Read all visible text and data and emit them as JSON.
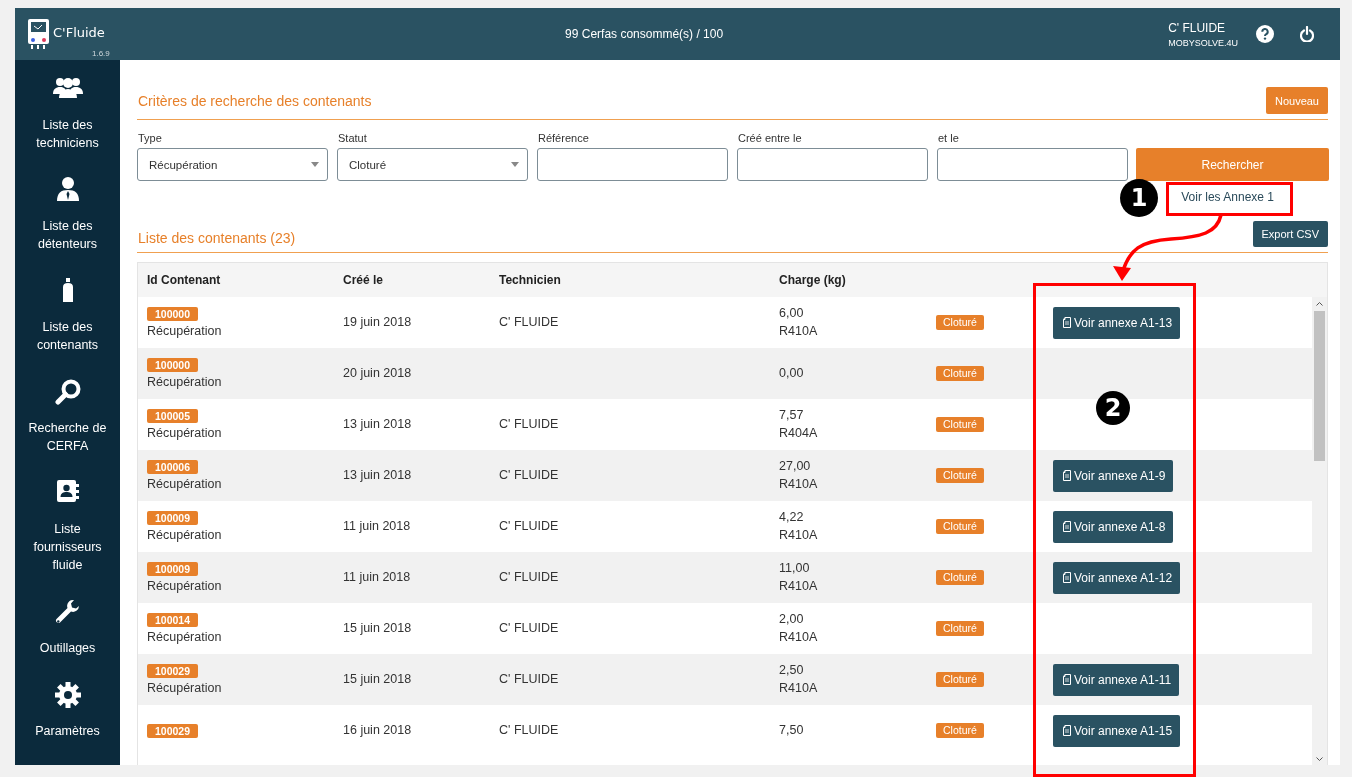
{
  "header": {
    "app_name": "C'Fluide",
    "version": "1.6.9",
    "quota": "99 Cerfas consommé(s) / 100",
    "user_name": "C' FLUIDE",
    "company": "MOBYSOLVE.4U"
  },
  "sidebar": {
    "items": [
      {
        "label": "Liste des techniciens",
        "kind": "users"
      },
      {
        "label": "Liste des détenteurs",
        "kind": "person"
      },
      {
        "label": "Liste des contenants",
        "kind": "bottle"
      },
      {
        "label": "Recherche de CERFA",
        "kind": "search"
      },
      {
        "label": "Liste fournisseurs fluide",
        "kind": "contacts"
      },
      {
        "label": "Outillages",
        "kind": "wrench"
      },
      {
        "label": "Paramètres",
        "kind": "gear"
      }
    ]
  },
  "search": {
    "title": "Critères de recherche des contenants",
    "new_button": "Nouveau",
    "filters": [
      {
        "label": "Type",
        "kind": "select",
        "value": "Récupération"
      },
      {
        "label": "Statut",
        "kind": "select",
        "value": "Cloturé"
      },
      {
        "label": "Référence",
        "kind": "text"
      },
      {
        "label": "Créé entre le",
        "kind": "text"
      },
      {
        "label": "et le",
        "kind": "text"
      }
    ],
    "search_button": "Rechercher",
    "annex_link": "Voir les Annexe 1"
  },
  "list": {
    "title": "Liste des contenants (23)",
    "export_button": "Export CSV",
    "columns": [
      "Id Contenant",
      "Créé le",
      "Technicien",
      "Charge (kg)"
    ],
    "rows": [
      {
        "id": "100000",
        "type": "Récupération",
        "created": "19 juin 2018",
        "technician": "C' FLUIDE",
        "charge": "6,00",
        "fluid": "R410A",
        "status": "Cloturé",
        "annex_button": "Voir annexe A1-13"
      },
      {
        "id": "100000",
        "type": "Récupération",
        "created": "20 juin 2018",
        "charge": "0,00",
        "status": "Cloturé"
      },
      {
        "id": "100005",
        "type": "Récupération",
        "created": "13 juin 2018",
        "technician": "C' FLUIDE",
        "charge": "7,57",
        "fluid": "R404A",
        "status": "Cloturé"
      },
      {
        "id": "100006",
        "type": "Récupération",
        "created": "13 juin 2018",
        "technician": "C' FLUIDE",
        "charge": "27,00",
        "fluid": "R410A",
        "status": "Cloturé",
        "annex_button": "Voir annexe A1-9"
      },
      {
        "id": "100009",
        "type": "Récupération",
        "created": "11 juin 2018",
        "technician": "C' FLUIDE",
        "charge": "4,22",
        "fluid": "R410A",
        "status": "Cloturé",
        "annex_button": "Voir annexe A1-8"
      },
      {
        "id": "100009",
        "type": "Récupération",
        "created": "11 juin 2018",
        "technician": "C' FLUIDE",
        "charge": "11,00",
        "fluid": "R410A",
        "status": "Cloturé",
        "annex_button": "Voir annexe A1-12"
      },
      {
        "id": "100014",
        "type": "Récupération",
        "created": "15 juin 2018",
        "technician": "C' FLUIDE",
        "charge": "2,00",
        "fluid": "R410A",
        "status": "Cloturé"
      },
      {
        "id": "100029",
        "type": "Récupération",
        "created": "15 juin 2018",
        "technician": "C' FLUIDE",
        "charge": "2,50",
        "fluid": "R410A",
        "status": "Cloturé",
        "annex_button": "Voir annexe A1-11"
      },
      {
        "id": "100029",
        "created": "16 juin 2018",
        "technician": "C' FLUIDE",
        "charge": "7,50",
        "status": "Cloturé",
        "annex_button": "Voir annexe A1-15"
      }
    ]
  },
  "annotations": [
    {
      "number": "1"
    },
    {
      "number": "2"
    }
  ]
}
